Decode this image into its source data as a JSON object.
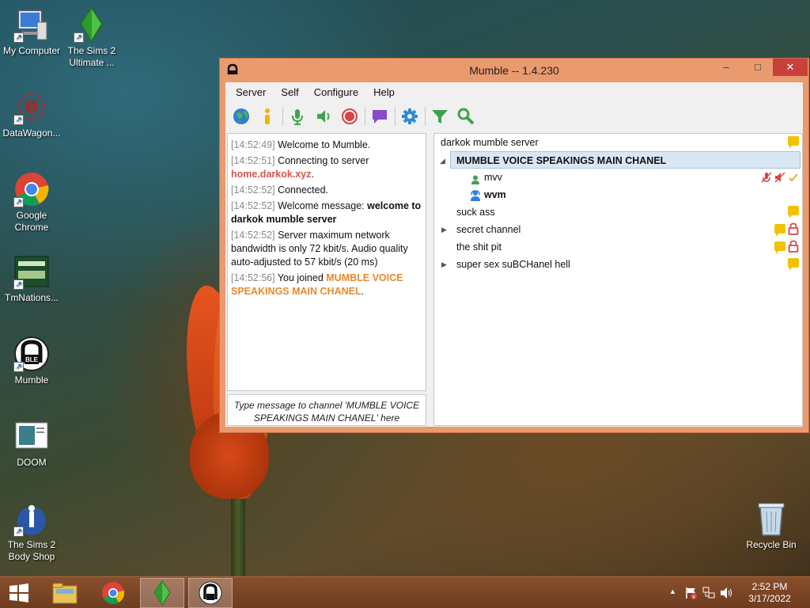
{
  "desktop": {
    "icons": [
      {
        "label": "My Computer"
      },
      {
        "label": "The Sims 2 Ultimate ..."
      },
      {
        "label": "DataWagon..."
      },
      {
        "label": "Google Chrome"
      },
      {
        "label": "TmNations..."
      },
      {
        "label": "Mumble"
      },
      {
        "label": "DOOM"
      },
      {
        "label": "The Sims 2 Body Shop"
      },
      {
        "label": "Recycle Bin"
      }
    ]
  },
  "window": {
    "title": "Mumble -- 1.4.230",
    "controls": {
      "minimize": "–",
      "maximize": "□",
      "close": "✕"
    }
  },
  "menu": [
    "Server",
    "Self",
    "Configure",
    "Help"
  ],
  "toolbar": [
    "connect-icon",
    "info-icon",
    "microphone-icon",
    "speaker-icon",
    "record-icon",
    "chat-icon",
    "settings-icon",
    "filter-icon",
    "search-icon"
  ],
  "log": [
    {
      "ts": "[14:52:49]",
      "text": " Welcome to Mumble."
    },
    {
      "ts": "[14:52:51]",
      "text": " Connecting to server ",
      "link": "home.darkok.xyz",
      "after": "."
    },
    {
      "ts": "[14:52:52]",
      "text": " Connected."
    },
    {
      "ts": "[14:52:52]",
      "text": " Welcome message: ",
      "bold": "welcome to darkok mumble server"
    },
    {
      "ts": "[14:52:52]",
      "text": " Server maximum network bandwidth is only 72 kbit/s. Audio quality auto-adjusted to 57 kbit/s (20 ms)"
    },
    {
      "ts": "[14:52:56]",
      "text": " You joined ",
      "channel": "MUMBLE VOICE SPEAKINGS MAIN CHANEL",
      "after": "."
    }
  ],
  "message_placeholder": "Type message to channel 'MUMBLE VOICE SPEAKINGS MAIN CHANEL' here",
  "tree": {
    "server": "darkok mumble server",
    "main_channel": "MUMBLE VOICE SPEAKINGS MAIN CHANEL",
    "users": [
      "mvv",
      "wvm"
    ],
    "channels": [
      "suck ass",
      "secret channel",
      "the shit pit",
      "super sex suBCHanel hell"
    ]
  },
  "taskbar": {
    "clock_time": "2:52 PM",
    "clock_date": "3/17/2022",
    "tray_up": "▲"
  },
  "colors": {
    "window_frame": "#e99a6e",
    "close_button": "#c7403a",
    "link_red": "#d9534f",
    "link_orange": "#e68a2e",
    "taskbar": "#7a4526"
  }
}
